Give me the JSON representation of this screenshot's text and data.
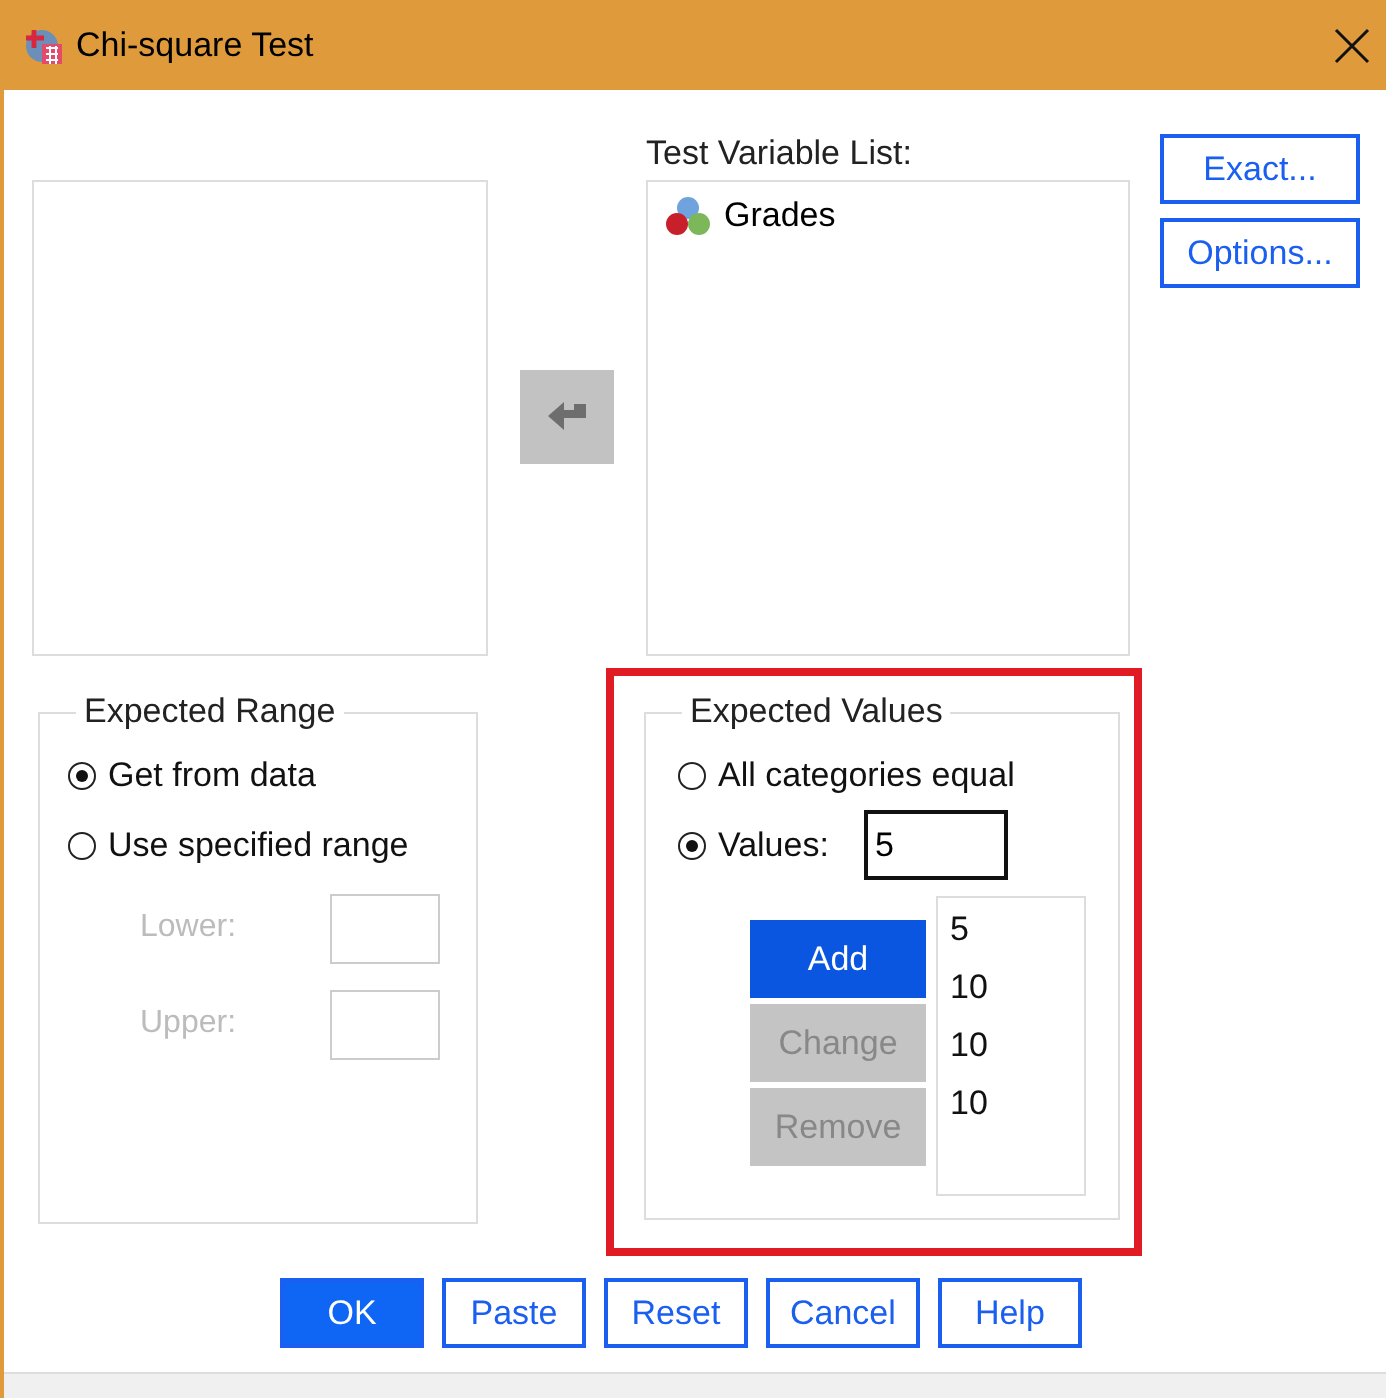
{
  "window": {
    "title": "Chi-square Test"
  },
  "test_variable_list": {
    "label": "Test Variable List:",
    "items": [
      {
        "name": "Grades"
      }
    ]
  },
  "side_buttons": [
    "Exact...",
    "Options..."
  ],
  "expected_range": {
    "title": "Expected Range",
    "options": [
      {
        "label": "Get from data",
        "selected": true
      },
      {
        "label": "Use specified range",
        "selected": false
      }
    ],
    "fields": [
      {
        "label": "Lower:",
        "disabled": true
      },
      {
        "label": "Upper:",
        "disabled": true
      }
    ]
  },
  "expected_values": {
    "title": "Expected Values",
    "highlighted": true,
    "options": [
      {
        "label": "All categories equal",
        "selected": false
      },
      {
        "label": "Values:",
        "selected": true
      }
    ],
    "value_input": "5",
    "buttons": [
      {
        "label": "Add",
        "kind": "primary"
      },
      {
        "label": "Change",
        "kind": "disabled"
      },
      {
        "label": "Remove",
        "kind": "disabled"
      }
    ],
    "values": [
      "5",
      "10",
      "10",
      "10"
    ]
  },
  "buttons": [
    {
      "label": "OK",
      "kind": "primary"
    },
    {
      "label": "Paste",
      "kind": "normal"
    },
    {
      "label": "Reset",
      "kind": "normal"
    },
    {
      "label": "Cancel",
      "kind": "normal"
    },
    {
      "label": "Help",
      "kind": "normal"
    }
  ]
}
